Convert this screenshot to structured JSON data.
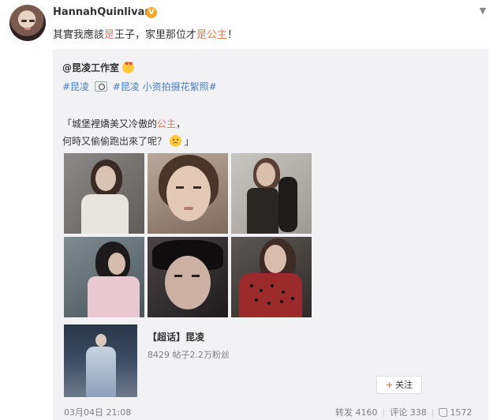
{
  "user": {
    "name": "HannahQuinlivan",
    "badge": "V"
  },
  "post": {
    "text_parts": [
      "其實我應該",
      "是",
      "王子，家里那位才",
      "是公主",
      "！"
    ]
  },
  "repost": {
    "author": "@昆凌工作室",
    "tags": [
      "#昆凌",
      "#昆凌 小资拍摄花絮照#"
    ],
    "caption_line1_parts": [
      "「城堡裡嬌美又冷傲的",
      "公主",
      "，"
    ],
    "caption_line2": "何時又偷偷跑出來了呢？",
    "caption_line2_end": "」",
    "topic": {
      "title": "【超话】昆凌",
      "stats": "8429 帖子2.2万粉丝",
      "follow_label": "关注",
      "follow_plus": "+"
    },
    "time": "03月04日 21:08",
    "actions": {
      "forward": "转发 4160",
      "comment": "评论 338",
      "like": "1572"
    }
  },
  "icons": {
    "dropdown": "chevron-down-icon",
    "author_emoji": "heart-eyes-emoji",
    "caption_emoji": "crying-emoji",
    "camera": "camera-icon",
    "like": "thumbs-up-icon"
  },
  "colors": {
    "highlight": "#eb7350",
    "link": "#4a7fc0",
    "repost_bg": "#f2f2f5",
    "vip_badge": "#f5a623"
  }
}
